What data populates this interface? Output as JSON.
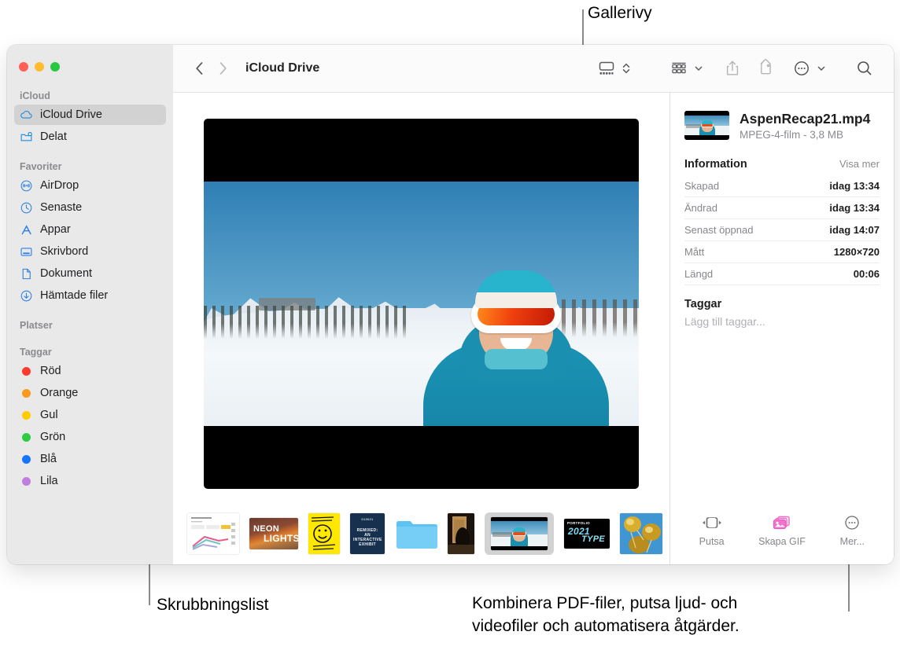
{
  "callouts": {
    "gallery": "Gallerivy",
    "scrubber": "Skrubbningslist",
    "more_line1": "Kombinera PDF-filer, putsa ljud- och",
    "more_line2": "videofiler och automatisera åtgärder."
  },
  "window": {
    "traffic_lights": [
      {
        "name": "close",
        "color": "#ff5f57"
      },
      {
        "name": "minimize",
        "color": "#febc2e"
      },
      {
        "name": "zoom",
        "color": "#28c840"
      }
    ]
  },
  "sidebar": {
    "sections": [
      {
        "title": "iCloud",
        "items": [
          {
            "label": "iCloud Drive",
            "icon": "cloud-icon",
            "selected": true
          },
          {
            "label": "Delat",
            "icon": "shared-folder-icon",
            "selected": false
          }
        ]
      },
      {
        "title": "Favoriter",
        "items": [
          {
            "label": "AirDrop",
            "icon": "airdrop-icon",
            "selected": false
          },
          {
            "label": "Senaste",
            "icon": "clock-icon",
            "selected": false
          },
          {
            "label": "Appar",
            "icon": "apps-icon",
            "selected": false
          },
          {
            "label": "Skrivbord",
            "icon": "desktop-icon",
            "selected": false
          },
          {
            "label": "Dokument",
            "icon": "document-icon",
            "selected": false
          },
          {
            "label": "Hämtade filer",
            "icon": "downloads-icon",
            "selected": false
          }
        ]
      },
      {
        "title": "Platser",
        "items": []
      },
      {
        "title": "Taggar",
        "items": [
          {
            "label": "Röd",
            "icon": "tag-dot",
            "color": "#fc3b2d"
          },
          {
            "label": "Orange",
            "icon": "tag-dot",
            "color": "#f8991d"
          },
          {
            "label": "Gul",
            "icon": "tag-dot",
            "color": "#ffcc00"
          },
          {
            "label": "Grön",
            "icon": "tag-dot",
            "color": "#2ecc40"
          },
          {
            "label": "Blå",
            "icon": "tag-dot",
            "color": "#1575ff"
          },
          {
            "label": "Lila",
            "icon": "tag-dot",
            "color": "#c07ee0"
          }
        ]
      }
    ]
  },
  "toolbar": {
    "back": "back-icon",
    "forward": "forward-icon",
    "title": "iCloud Drive",
    "view_gallery": "gallery-view-icon",
    "view_stepper": "view-stepper-icon",
    "group_by": "group-by-icon",
    "group_chevron": "chevron-down-icon",
    "share": "share-icon",
    "tag": "tag-icon",
    "more": "more-circle-icon",
    "more_chevron": "chevron-down-icon",
    "search": "search-icon"
  },
  "info": {
    "file_name": "AspenRecap21.mp4",
    "file_meta": "MPEG-4-film - 3,8 MB",
    "section_title": "Information",
    "show_more": "Visa mer",
    "rows": [
      {
        "key": "Skapad",
        "value": "idag 13:34"
      },
      {
        "key": "Ändrad",
        "value": "idag 13:34"
      },
      {
        "key": "Senast öppnad",
        "value": "idag 14:07"
      },
      {
        "key": "Mått",
        "value": "1280×720"
      },
      {
        "key": "Längd",
        "value": "00:06"
      }
    ],
    "tags_title": "Taggar",
    "tags_placeholder": "Lägg till taggar...",
    "actions": [
      {
        "label": "Putsa",
        "icon": "trim-icon"
      },
      {
        "label": "Skapa GIF",
        "icon": "create-gif-icon"
      },
      {
        "label": "Mer...",
        "icon": "more-circle-icon"
      }
    ]
  },
  "scrubber": {
    "thumbnails": [
      {
        "name": "chart-document",
        "kind": "chart",
        "selected": false
      },
      {
        "name": "neon-lights-poster",
        "kind": "neon",
        "label_top": "NEON",
        "label_bottom": "LIGHTS",
        "selected": false
      },
      {
        "name": "thank-you-poster",
        "kind": "smiley",
        "selected": false
      },
      {
        "name": "exhibit-poster",
        "kind": "exhibit",
        "label_top": "013021",
        "label_mid": "REMIXED: AN INTERACTIVE EXHIBIT",
        "selected": false
      },
      {
        "name": "folder",
        "kind": "folder",
        "selected": false
      },
      {
        "name": "dark-photo",
        "kind": "dark",
        "selected": false
      },
      {
        "name": "aspen-recap-video",
        "kind": "video",
        "selected": true
      },
      {
        "name": "typography-poster",
        "kind": "type",
        "label_top": "PORTFOLIO",
        "label_mid": "2021",
        "label_bottom": "TYPE",
        "selected": false
      },
      {
        "name": "gold-balloons-photo",
        "kind": "gold",
        "selected": false
      }
    ]
  },
  "preview": {
    "name": "aspen-recap-video-preview"
  }
}
